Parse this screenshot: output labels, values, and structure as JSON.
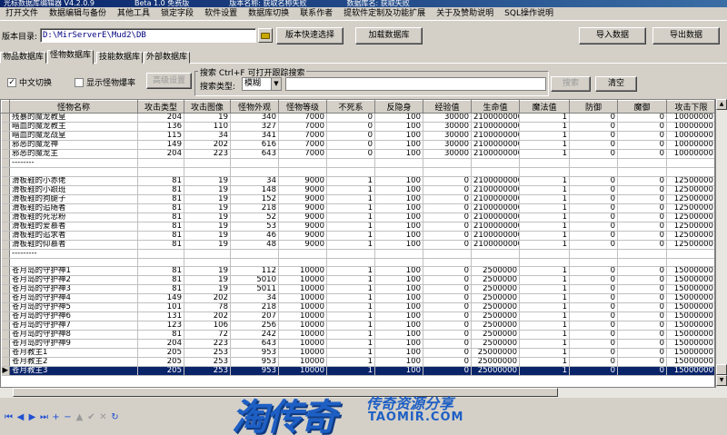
{
  "window": {
    "title_parts": [
      "光标数据库编辑器 V4.2.0.9",
      "Beta 1.0 免费版",
      "版本名称: 获取名称失败",
      "数据库名: 获取失败"
    ]
  },
  "menu": [
    "打开文件",
    "数据编辑与备份",
    "其他工具",
    "锁定字段",
    "软件设置",
    "数据库切换",
    "联系作者",
    "提软件定制及功能扩展",
    "关于及赞助说明",
    "SQL操作说明"
  ],
  "toolbar": {
    "dir_label": "版本目录:",
    "dir_value": "D:\\MirServerE\\Mud2\\DB",
    "quick_select": "版本快速选择",
    "load_db": "加载数据库",
    "import": "导入数据",
    "export": "导出数据"
  },
  "tabs": [
    "物品数据库",
    "怪物数据库",
    "技能数据库",
    "外部数据库"
  ],
  "active_tab": 1,
  "filters": {
    "chinese_toggle": "中文切换",
    "chinese_checked": "✓",
    "show_monster_lib": "显示怪物爆率",
    "advanced": "高级设置",
    "search_legend": "搜索  Ctrl+F 可打开跟踪搜索",
    "search_type_label": "搜索类型:",
    "search_type_value": "模糊",
    "search_button": "搜索",
    "clear_button": "清空"
  },
  "grid": {
    "columns": [
      "怪物名称",
      "攻击类型",
      "攻击图像",
      "怪物外观",
      "怪物等级",
      "不死系",
      "反隐身",
      "经验值",
      "生命值",
      "魔法值",
      "防御",
      "魔御",
      "攻击下限"
    ],
    "rows": [
      [
        "残暴的魔龙教皇",
        "204",
        "19",
        "340",
        "7000",
        "0",
        "100",
        "30000",
        "2100000000",
        "1",
        "0",
        "0",
        "10000000"
      ],
      [
        "暗血的魔龙教主",
        "136",
        "110",
        "327",
        "7000",
        "0",
        "100",
        "30000",
        "2100000000",
        "1",
        "0",
        "0",
        "10000000"
      ],
      [
        "暗血的魔龙战皇",
        "115",
        "34",
        "341",
        "7000",
        "0",
        "100",
        "30000",
        "2100000000",
        "1",
        "0",
        "0",
        "10000000"
      ],
      [
        "邪恶的魔龙神",
        "149",
        "202",
        "616",
        "7000",
        "0",
        "100",
        "30000",
        "2100000000",
        "1",
        "0",
        "0",
        "10000000"
      ],
      [
        "邪恶的魔龙主",
        "204",
        "223",
        "643",
        "7000",
        "0",
        "100",
        "30000",
        "2100000000",
        "1",
        "0",
        "0",
        "10000000"
      ],
      [
        "--------",
        "",
        "",
        "",
        "",
        "",
        "",
        "",
        "",
        "",
        "",
        "",
        ""
      ],
      [
        "",
        "",
        "",
        "",
        "",
        "",
        "",
        "",
        "",
        "",
        "",
        "",
        ""
      ],
      [
        "滑板鞋的小赤佬",
        "81",
        "19",
        "34",
        "9000",
        "1",
        "100",
        "0",
        "2100000000",
        "1",
        "0",
        "0",
        "12500000"
      ],
      [
        "滑板鞋的小跟班",
        "81",
        "19",
        "148",
        "9000",
        "1",
        "100",
        "0",
        "2100000000",
        "1",
        "0",
        "0",
        "12500000"
      ],
      [
        "滑板鞋的狗腿子",
        "81",
        "19",
        "152",
        "9000",
        "1",
        "100",
        "0",
        "2100000000",
        "1",
        "0",
        "0",
        "12500000"
      ],
      [
        "滑板鞋的追随者",
        "81",
        "19",
        "218",
        "9000",
        "1",
        "100",
        "0",
        "2100000000",
        "1",
        "0",
        "0",
        "12500000"
      ],
      [
        "滑板鞋的死忠粉",
        "81",
        "19",
        "52",
        "9000",
        "1",
        "100",
        "0",
        "2100000000",
        "1",
        "0",
        "0",
        "12500000"
      ],
      [
        "滑板鞋的爱慕者",
        "81",
        "19",
        "53",
        "9000",
        "1",
        "100",
        "0",
        "2100000000",
        "1",
        "0",
        "0",
        "12500000"
      ],
      [
        "滑板鞋的追求者",
        "81",
        "19",
        "46",
        "9000",
        "1",
        "100",
        "0",
        "2100000000",
        "1",
        "0",
        "0",
        "12500000"
      ],
      [
        "滑板鞋的仰慕者",
        "81",
        "19",
        "48",
        "9000",
        "1",
        "100",
        "0",
        "2100000000",
        "1",
        "0",
        "0",
        "12500000"
      ],
      [
        "---------",
        "",
        "",
        "",
        "",
        "",
        "",
        "",
        "",
        "",
        "",
        "",
        ""
      ],
      [
        "",
        "",
        "",
        "",
        "",
        "",
        "",
        "",
        "",
        "",
        "",
        "",
        ""
      ],
      [
        "苍月岛的守护神1",
        "81",
        "19",
        "112",
        "10000",
        "1",
        "100",
        "0",
        "2500000",
        "1",
        "0",
        "0",
        "15000000"
      ],
      [
        "苍月岛的守护神2",
        "81",
        "19",
        "5010",
        "10000",
        "1",
        "100",
        "0",
        "2500000",
        "1",
        "0",
        "0",
        "15000000"
      ],
      [
        "苍月岛的守护神3",
        "81",
        "19",
        "5011",
        "10000",
        "1",
        "100",
        "0",
        "2500000",
        "1",
        "0",
        "0",
        "15000000"
      ],
      [
        "苍月岛的守护神4",
        "149",
        "202",
        "34",
        "10000",
        "1",
        "100",
        "0",
        "2500000",
        "1",
        "0",
        "0",
        "15000000"
      ],
      [
        "苍月岛的守护神5",
        "101",
        "78",
        "218",
        "10000",
        "1",
        "100",
        "0",
        "2500000",
        "1",
        "0",
        "0",
        "15000000"
      ],
      [
        "苍月岛的守护神6",
        "131",
        "202",
        "207",
        "10000",
        "1",
        "100",
        "0",
        "2500000",
        "1",
        "0",
        "0",
        "15000000"
      ],
      [
        "苍月岛的守护神7",
        "123",
        "106",
        "256",
        "10000",
        "1",
        "100",
        "0",
        "2500000",
        "1",
        "0",
        "0",
        "15000000"
      ],
      [
        "苍月岛的守护神8",
        "81",
        "72",
        "242",
        "10000",
        "1",
        "100",
        "0",
        "2500000",
        "1",
        "0",
        "0",
        "15000000"
      ],
      [
        "苍月岛的守护神9",
        "204",
        "223",
        "643",
        "10000",
        "1",
        "100",
        "0",
        "2500000",
        "1",
        "0",
        "0",
        "15000000"
      ],
      [
        "苍月教主1",
        "205",
        "253",
        "953",
        "10000",
        "1",
        "100",
        "0",
        "25000000",
        "1",
        "0",
        "0",
        "15000000"
      ],
      [
        "苍月教主2",
        "205",
        "253",
        "953",
        "10000",
        "1",
        "100",
        "0",
        "25000000",
        "1",
        "0",
        "0",
        "15000000"
      ],
      [
        "苍月教主3",
        "205",
        "253",
        "953",
        "10000",
        "1",
        "100",
        "0",
        "25000000",
        "1",
        "0",
        "0",
        "15000000"
      ]
    ],
    "selected_row": 28,
    "row_indicator": "▶"
  },
  "navigator": {
    "buttons": [
      {
        "name": "first-record-icon",
        "glyph": "⏮"
      },
      {
        "name": "prior-record-icon",
        "glyph": "◀"
      },
      {
        "name": "next-record-icon",
        "glyph": "▶"
      },
      {
        "name": "last-record-icon",
        "glyph": "⏭"
      },
      {
        "name": "insert-record-icon",
        "glyph": "+"
      },
      {
        "name": "delete-record-icon",
        "glyph": "−"
      },
      {
        "name": "edit-record-icon",
        "glyph": "▲"
      },
      {
        "name": "post-record-icon",
        "glyph": "✔"
      },
      {
        "name": "cancel-record-icon",
        "glyph": "✕"
      },
      {
        "name": "refresh-record-icon",
        "glyph": "↻"
      }
    ]
  },
  "watermark": {
    "big": "淘传奇",
    "small": "传奇资源分享",
    "url": "TAOMIR.COM"
  }
}
